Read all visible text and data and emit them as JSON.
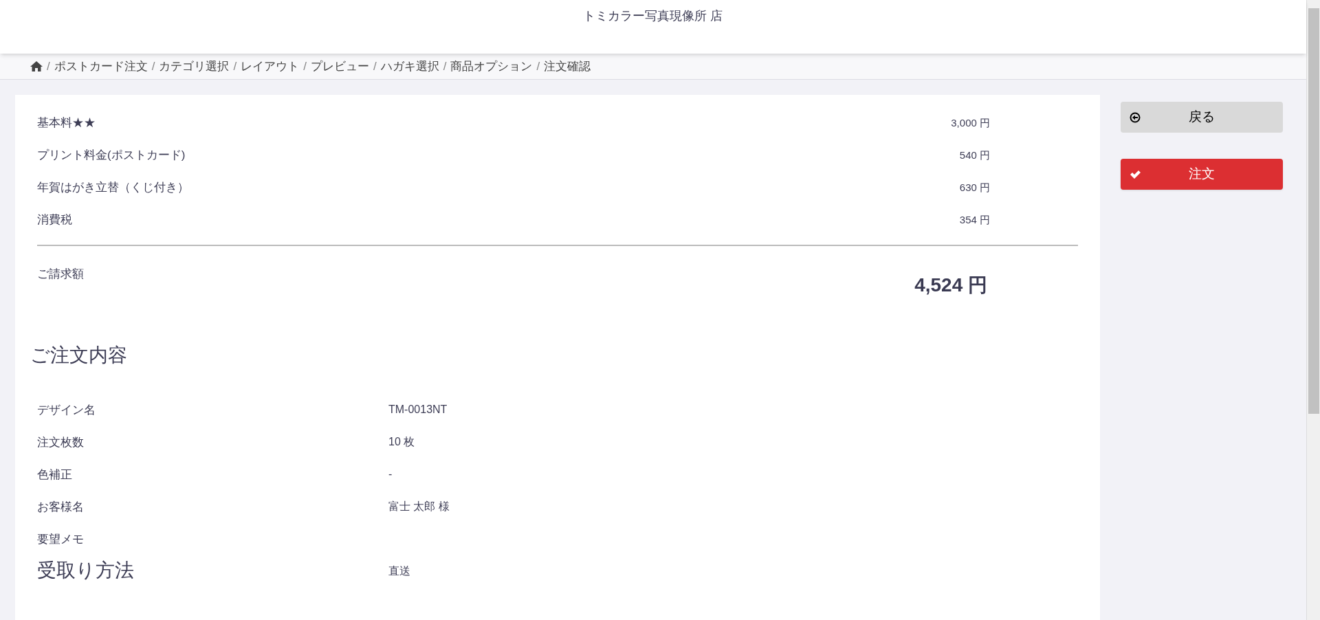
{
  "header": {
    "title": "トミカラー写真現像所 店"
  },
  "breadcrumb": [
    {
      "separator": "/",
      "label": "ポストカード注文"
    },
    {
      "separator": "/",
      "label": "カテゴリ選択"
    },
    {
      "separator": "/",
      "label": "レイアウト"
    },
    {
      "separator": "/",
      "label": "プレビュー"
    },
    {
      "separator": "/",
      "label": "ハガキ選択"
    },
    {
      "separator": "/",
      "label": "商品オプション"
    },
    {
      "separator": "/",
      "label": "注文確認"
    }
  ],
  "charges": [
    {
      "label": "基本料★★",
      "amount": "3,000 円"
    },
    {
      "label": "プリント料金(ポストカード)",
      "amount": "540 円"
    },
    {
      "label": "年賀はがき立替（くじ付き）",
      "amount": "630 円"
    },
    {
      "label": "消費税",
      "amount": "354 円"
    }
  ],
  "total": {
    "label": "ご請求額",
    "amount": "4,524 円"
  },
  "order_details": {
    "heading": "ご注文内容",
    "rows": [
      {
        "kind": "normal",
        "label": "デザイン名",
        "value": "TM-0013NT"
      },
      {
        "kind": "normal",
        "label": "注文枚数",
        "value": "10 枚"
      },
      {
        "kind": "normal",
        "label": "色補正",
        "value": "-"
      },
      {
        "kind": "normal",
        "label": "お客様名",
        "value": "富士 太郎 様"
      },
      {
        "kind": "normal",
        "label": "要望メモ"
      },
      {
        "kind": "large",
        "label": "受取り方法",
        "value": "直送"
      }
    ]
  },
  "actions": [
    {
      "kind": "back",
      "label": "戻る"
    },
    {
      "kind": "order",
      "label": "注文"
    }
  ]
}
